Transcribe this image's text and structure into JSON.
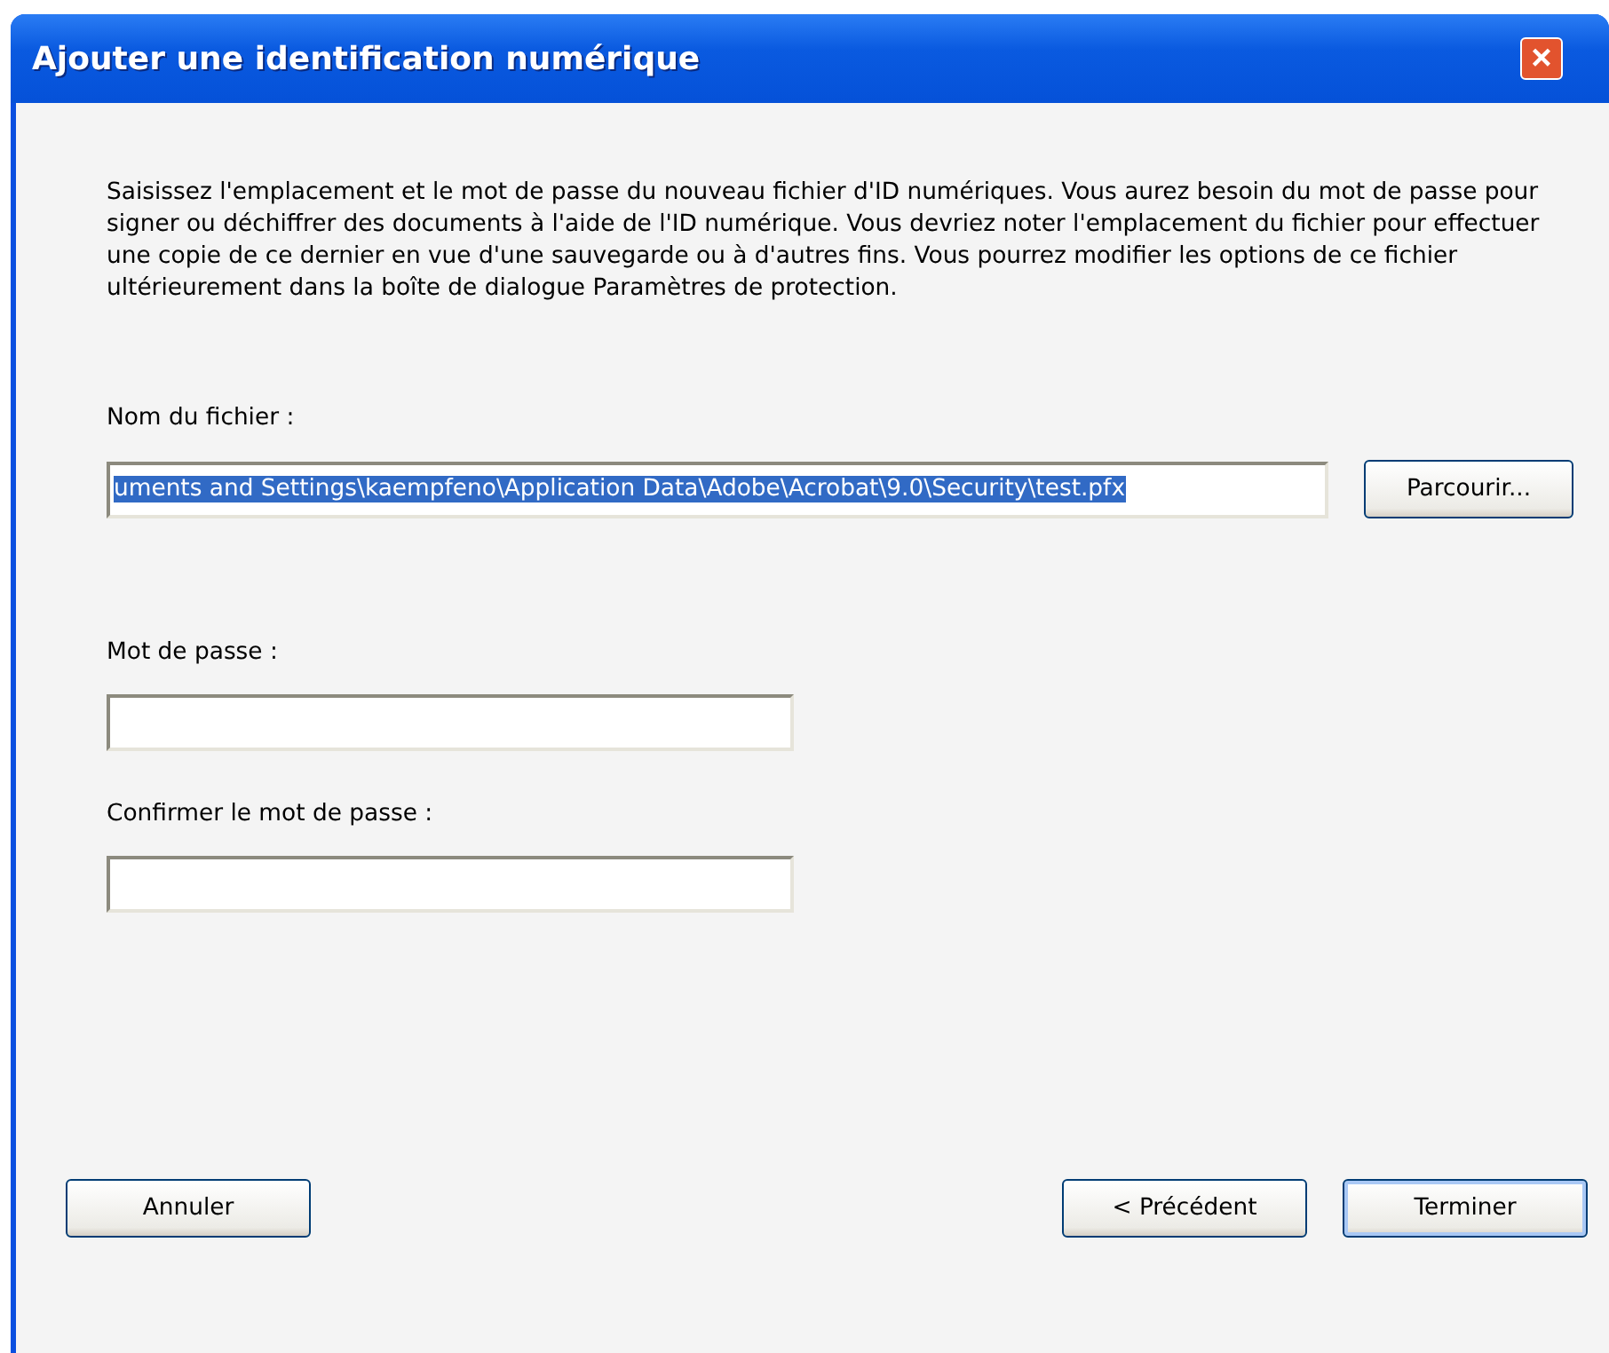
{
  "window": {
    "title": "Ajouter une identification numérique",
    "close": "×"
  },
  "intro": "Saisissez l'emplacement et le mot de passe du nouveau fichier d'ID numériques. Vous aurez besoin du mot de passe pour signer ou déchiffrer des documents à l'aide de l'ID numérique. Vous devriez noter l'emplacement du fichier pour effectuer une copie de ce dernier en vue d'une sauvegarde ou à d'autres fins. Vous pourrez modifier les options de ce fichier ultérieurement dans la boîte de dialogue Paramètres de protection.",
  "file": {
    "label": "Nom du fichier :",
    "value": "uments and Settings\\kaempfeno\\Application Data\\Adobe\\Acrobat\\9.0\\Security\\test.pfx",
    "selected": true,
    "browse": "Parcourir..."
  },
  "fields": [
    {
      "label": "Mot de passe :"
    },
    {
      "label": "Confirmer le mot de passe :"
    }
  ],
  "buttons": [
    {
      "label": "Annuler",
      "default": false
    },
    {
      "label": "< Précédent",
      "default": false
    },
    {
      "label": "Terminer",
      "default": true
    }
  ]
}
